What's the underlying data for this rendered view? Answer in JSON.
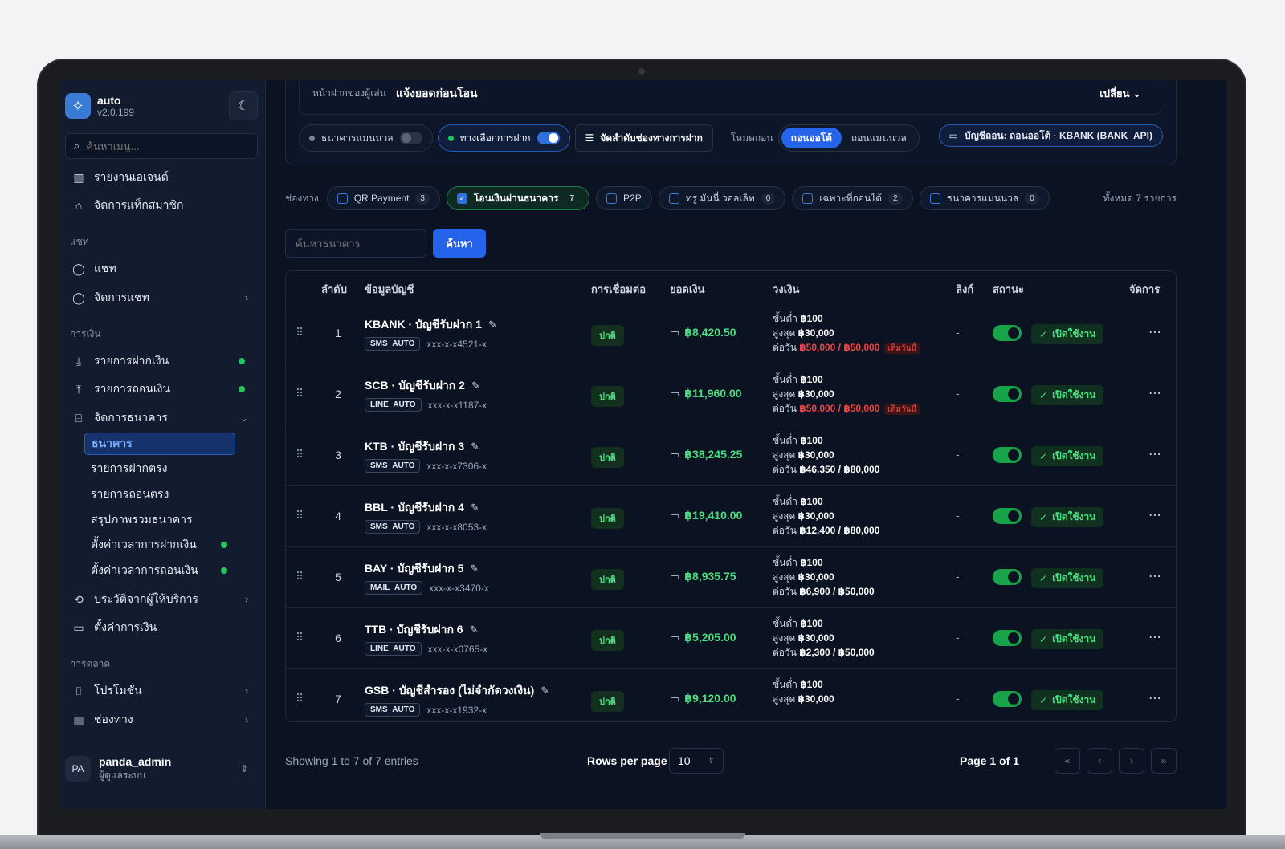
{
  "sidebar": {
    "brand_name": "auto",
    "version": "v2.0.199",
    "search_placeholder": "ค้นหาเมนู...",
    "items_top": [
      {
        "label": "รายงานเอเจนต์",
        "icon": "bar-chart-icon"
      },
      {
        "label": "จัดการแท็กสมาชิก",
        "icon": "tag-icon"
      }
    ],
    "section_chat": "แชท",
    "chat_items": [
      {
        "label": "แชท",
        "icon": "chat-icon"
      },
      {
        "label": "จัดการแชท",
        "icon": "chat-icon"
      }
    ],
    "section_finance": "การเงิน",
    "finance_items": [
      {
        "label": "รายการฝากเงิน",
        "icon": "download-icon"
      },
      {
        "label": "รายการถอนเงิน",
        "icon": "upload-icon"
      },
      {
        "label": "จัดการธนาคาร",
        "icon": "bank-icon"
      }
    ],
    "bank_sub": [
      {
        "label": "ธนาคาร"
      },
      {
        "label": "รายการฝากตรง"
      },
      {
        "label": "รายการถอนตรง"
      },
      {
        "label": "สรุปภาพรวมธนาคาร"
      },
      {
        "label": "ตั้งค่าเวลาการฝากเงิน"
      },
      {
        "label": "ตั้งค่าเวลาการถอนเงิน"
      }
    ],
    "finance_items2": [
      {
        "label": "ประวัติจากผู้ให้บริการ",
        "icon": "history-icon"
      },
      {
        "label": "ตั้งค่าการเงิน",
        "icon": "wallet-icon"
      }
    ],
    "section_marketing": "การตลาด",
    "marketing_items": [
      {
        "label": "โปรโมชั่น",
        "icon": "gift-icon"
      },
      {
        "label": "ช่องทาง",
        "icon": "bar-chart-icon"
      }
    ],
    "user": {
      "initials": "PA",
      "name": "panda_admin",
      "role": "ผู้ดูแลระบบ"
    }
  },
  "notice": {
    "label": "หน้าฝากของผู้เล่น",
    "value": "แจ้งยอดก่อนโอน",
    "change": "เปลี่ยน"
  },
  "toggles": {
    "manual_bank": "ธนาคารแมนนวล",
    "deposit_choice": "ทางเลือกการฝาก",
    "sort_channels": "จัดลำดับช่องทางการฝาก",
    "withdraw_mode_label": "โหมดถอน",
    "mode_auto": "ถอนออโต้",
    "mode_manual": "ถอนแมนนวล",
    "withdraw_account": "บัญชีถอน: ถอนออโต้ · KBANK (BANK_API)"
  },
  "channels": {
    "label": "ช่องทาง",
    "chips": [
      {
        "label": "QR Payment",
        "count": "3",
        "checked": false
      },
      {
        "label": "โอนเงินผ่านธนาคาร",
        "count": "7",
        "checked": true
      },
      {
        "label": "P2P",
        "count": "",
        "checked": false
      },
      {
        "label": "ทรู มันนี่ วอลเล็ท",
        "count": "0",
        "checked": false
      },
      {
        "label": "เฉพาะที่ถอนได้",
        "count": "2",
        "checked": false
      },
      {
        "label": "ธนาคารแมนนวล",
        "count": "0",
        "checked": false
      }
    ],
    "total": "ทั้งหมด 7 รายการ"
  },
  "search": {
    "placeholder": "ค้นหาธนาคาร",
    "button": "ค้นหา"
  },
  "table": {
    "headers": {
      "order": "ลำดับ",
      "account": "ข้อมูลบัญชี",
      "connection": "การเชื่อมต่อ",
      "balance": "ยอดเงิน",
      "limit": "วงเงิน",
      "link": "ลิงก์",
      "status": "สถานะ",
      "manage": "จัดการ"
    },
    "limit_labels": {
      "min": "ขั้นต่ำ",
      "max": "สูงสุด",
      "daily": "ต่อวัน",
      "full": "เต็มวันนี้"
    },
    "rows": [
      {
        "no": "1",
        "name": "KBANK · บัญชีรับฝาก 1",
        "tag": "SMS_AUTO",
        "acct": "xxx-x-x4521-x",
        "conn": "ปกติ",
        "balance": "฿8,420.50",
        "min": "฿100",
        "max": "฿30,000",
        "daily": "฿50,000 / ฿50,000",
        "full": true,
        "link": "-",
        "status": "เปิดใช้งาน"
      },
      {
        "no": "2",
        "name": "SCB · บัญชีรับฝาก 2",
        "tag": "LINE_AUTO",
        "acct": "xxx-x-x1187-x",
        "conn": "ปกติ",
        "balance": "฿11,960.00",
        "min": "฿100",
        "max": "฿30,000",
        "daily": "฿50,000 / ฿50,000",
        "full": true,
        "link": "-",
        "status": "เปิดใช้งาน"
      },
      {
        "no": "3",
        "name": "KTB · บัญชีรับฝาก 3",
        "tag": "SMS_AUTO",
        "acct": "xxx-x-x7306-x",
        "conn": "ปกติ",
        "balance": "฿38,245.25",
        "min": "฿100",
        "max": "฿30,000",
        "daily": "฿46,350 / ฿80,000",
        "full": false,
        "link": "-",
        "status": "เปิดใช้งาน"
      },
      {
        "no": "4",
        "name": "BBL · บัญชีรับฝาก 4",
        "tag": "SMS_AUTO",
        "acct": "xxx-x-x8053-x",
        "conn": "ปกติ",
        "balance": "฿19,410.00",
        "min": "฿100",
        "max": "฿30,000",
        "daily": "฿12,400 / ฿80,000",
        "full": false,
        "link": "-",
        "status": "เปิดใช้งาน"
      },
      {
        "no": "5",
        "name": "BAY · บัญชีรับฝาก 5",
        "tag": "MAIL_AUTO",
        "acct": "xxx-x-x3470-x",
        "conn": "ปกติ",
        "balance": "฿8,935.75",
        "min": "฿100",
        "max": "฿30,000",
        "daily": "฿6,900 / ฿50,000",
        "full": false,
        "link": "-",
        "status": "เปิดใช้งาน"
      },
      {
        "no": "6",
        "name": "TTB · บัญชีรับฝาก 6",
        "tag": "LINE_AUTO",
        "acct": "xxx-x-x0765-x",
        "conn": "ปกติ",
        "balance": "฿5,205.00",
        "min": "฿100",
        "max": "฿30,000",
        "daily": "฿2,300 / ฿50,000",
        "full": false,
        "link": "-",
        "status": "เปิดใช้งาน"
      },
      {
        "no": "7",
        "name": "GSB · บัญชีสำรอง (ไม่จำกัดวงเงิน)",
        "tag": "SMS_AUTO",
        "acct": "xxx-x-x1932-x",
        "conn": "ปกติ",
        "balance": "฿9,120.00",
        "min": "฿100",
        "max": "฿30,000",
        "daily": "",
        "full": false,
        "link": "-",
        "status": "เปิดใช้งาน"
      }
    ]
  },
  "footer": {
    "info": "Showing 1 to 7 of 7 entries",
    "rows_per_page_label": "Rows per page",
    "rows_per_page": "10",
    "page_info": "Page 1 of 1"
  },
  "colors": {
    "accent": "#2563eb",
    "success": "#4ade80",
    "danger": "#ef4444",
    "bg": "#0b1322"
  }
}
